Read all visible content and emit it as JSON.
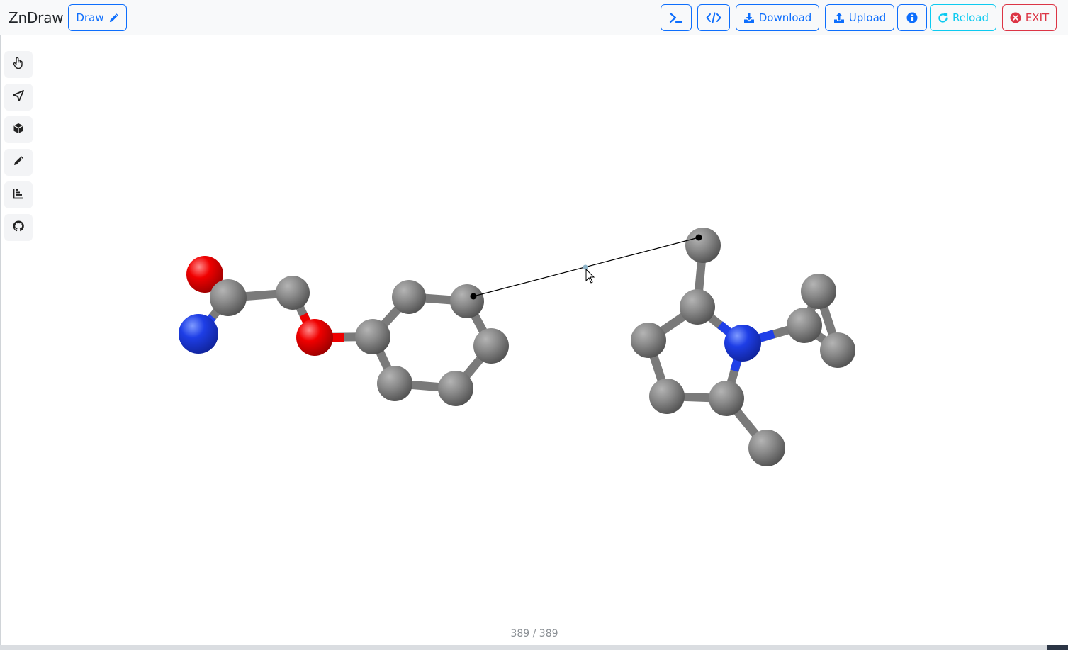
{
  "app": {
    "title": "ZnDraw"
  },
  "toolbar": {
    "draw_label": "Draw",
    "download_label": "Download",
    "upload_label": "Upload",
    "reload_label": "Reload",
    "exit_label": "EXIT"
  },
  "sidebar": {
    "items": [
      {
        "icon": "pointer-hand-icon"
      },
      {
        "icon": "location-arrow-icon"
      },
      {
        "icon": "cube-icon"
      },
      {
        "icon": "pencil-icon"
      },
      {
        "icon": "bar-chart-icon"
      },
      {
        "icon": "github-icon"
      }
    ]
  },
  "player": {
    "frame_counter": "389 / 389"
  },
  "colors": {
    "primary": "#0d6efd",
    "info": "#0dcaf0",
    "danger": "#dc3545",
    "carbon": "#7d7d7d",
    "oxygen": "#ff0000",
    "nitrogen": "#2040e8"
  }
}
